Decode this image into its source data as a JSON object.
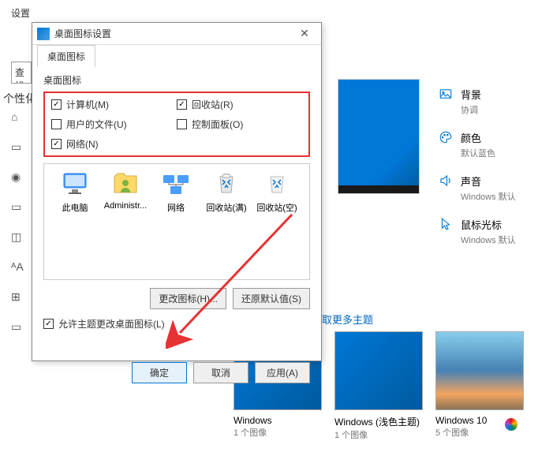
{
  "settings": {
    "title": "设置",
    "search": "查找",
    "section": "个性化"
  },
  "right": {
    "bg": {
      "title": "背景",
      "sub": "协调"
    },
    "color": {
      "title": "颜色",
      "sub": "默认蓝色"
    },
    "sound": {
      "title": "声音",
      "sub": "Windows 默认"
    },
    "cursor": {
      "title": "鼠标光标",
      "sub": "Windows 默认"
    }
  },
  "themes_link": "取更多主题",
  "themes": [
    {
      "name": "Windows",
      "count": "1 个图像"
    },
    {
      "name": "Windows (浅色主题)",
      "count": "1 个图像"
    },
    {
      "name": "Windows 10",
      "count": "5 个图像"
    }
  ],
  "dialog": {
    "title": "桌面图标设置",
    "tab": "桌面图标",
    "group_label": "桌面图标",
    "checkboxes": {
      "computer": "计算机(M)",
      "recycle": "回收站(R)",
      "userfiles": "用户的文件(U)",
      "control": "控制面板(O)",
      "network": "网络(N)"
    },
    "icons": [
      "此电脑",
      "Administr...",
      "网络",
      "回收站(满)",
      "回收站(空)"
    ],
    "change_icon": "更改图标(H)...",
    "restore_default": "还原默认值(S)",
    "allow_theme": "允许主题更改桌面图标(L)",
    "ok": "确定",
    "cancel": "取消",
    "apply": "应用(A)"
  }
}
